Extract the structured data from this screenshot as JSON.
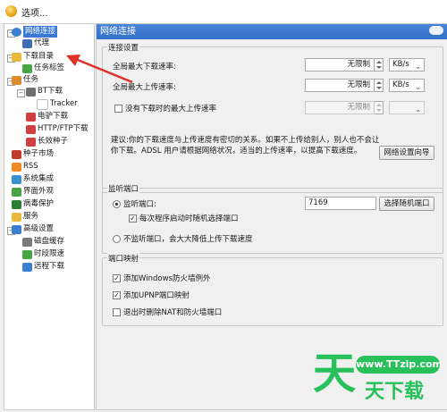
{
  "window": {
    "title": "选项..."
  },
  "tree": {
    "items": [
      {
        "label": "网络连接",
        "icon_color": "#3a7fd0"
      },
      {
        "label": "代理",
        "icon_color": "#3f6fb2"
      },
      {
        "label": "下载目录",
        "icon_color": "#e9b93c"
      },
      {
        "label": "任务标签",
        "icon_color": "#4aa443"
      },
      {
        "label": "任务",
        "icon_color": "#e08b2b"
      },
      {
        "label": "BT下载",
        "icon_color": "#6f6f6f"
      },
      {
        "label": "Tracker",
        "icon_color": "#ffffff"
      },
      {
        "label": "电驴下载",
        "icon_color": "#d04040"
      },
      {
        "label": "HTTP/FTP下载",
        "icon_color": "#d04040"
      },
      {
        "label": "长效种子",
        "icon_color": "#d04040"
      },
      {
        "label": "种子市场",
        "icon_color": "#c23a2a"
      },
      {
        "label": "RSS",
        "icon_color": "#f08a24"
      },
      {
        "label": "系统集成",
        "icon_color": "#3a8fcf"
      },
      {
        "label": "界面外观",
        "icon_color": "#4aa443"
      },
      {
        "label": "病毒保护",
        "icon_color": "#2e7d32"
      },
      {
        "label": "服务",
        "icon_color": "#e9b93c"
      },
      {
        "label": "高级设置",
        "icon_color": "#3a7fd0"
      },
      {
        "label": "磁盘缓存",
        "icon_color": "#7a7a7a"
      },
      {
        "label": "时段限速",
        "icon_color": "#4aa443"
      },
      {
        "label": "远程下载",
        "icon_color": "#3a7fd0"
      }
    ]
  },
  "panel": {
    "header": "网络连接",
    "connection": {
      "title": "连接设置",
      "max_download_label": "全局最大下载速率:",
      "max_download_value": "无限制",
      "max_download_unit": "KB/s",
      "max_upload_label": "全局最大上传速率:",
      "max_upload_value": "无限制",
      "max_upload_unit": "KB/s",
      "idle_upload_label": "没有下载时的最大上传速率",
      "idle_upload_value": "无限制",
      "note": "建议:你的下载速度与上传速度有密切的关系。如果不上传给别人，别人也不会让你下载。ADSL 用户请根据网络状况，适当的上传速率，以提高下载速度。",
      "wizard_button": "网络设置向导"
    },
    "listen": {
      "title": "监听端口",
      "port_label": "监听端口:",
      "port_value": "7169",
      "random_button": "选择随机端口",
      "random_on_start_label": "每次程序启动时随机选择端口",
      "no_listen_label": "不监听端口，会大大降低上传下载速度"
    },
    "mapping": {
      "title": "端口映射",
      "firewall_label": "添加Windows防火墙例外",
      "upnp_label": "添加UPNP端口映射",
      "remove_label": "退出时删除NAT和防火墙端口"
    }
  },
  "watermark": {
    "url": "www.TTzip.com",
    "big_char": "天",
    "small_text": "天下载"
  },
  "colors": {
    "header_blue": "#2f6fc9",
    "selection_blue": "#3a78d4",
    "annotation_red": "#e0302a",
    "watermark_green": "#27c05a"
  }
}
